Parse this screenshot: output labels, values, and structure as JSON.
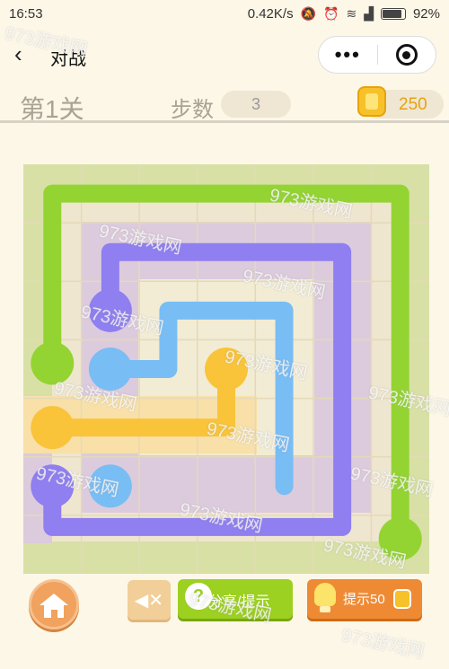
{
  "status_bar": {
    "time": "16:53",
    "network_speed": "0.42K/s",
    "battery": "92%",
    "icons": [
      "mute-icon",
      "alarm-icon",
      "wifi-icon",
      "signal-icon",
      "battery-icon"
    ]
  },
  "nav": {
    "title": "对战",
    "back_icon": "chevron-left-icon",
    "more_icon": "more-dots-icon",
    "close_icon": "target-close-icon"
  },
  "level": {
    "label": "第1关",
    "steps_label": "步数",
    "steps_value": "3",
    "coins": "250"
  },
  "board": {
    "rows": 7,
    "cols": 7,
    "colors": {
      "green": "#94d432",
      "purple": "#8f7ff0",
      "blue": "#79bdf5",
      "yellow": "#f9c43a",
      "grid_bg": "#f0e8d0",
      "grid_line": "#e5d9b9"
    },
    "paths": [
      {
        "color": "green",
        "cells": [
          [
            6,
            3
          ],
          [
            6,
            0
          ],
          [
            12,
            0
          ],
          [
            12,
            6
          ]
        ],
        "endpoints": [
          [
            0,
            3
          ],
          [
            6,
            6
          ]
        ]
      },
      {
        "color": "purple",
        "cells": [
          [
            1,
            2
          ],
          [
            1,
            1
          ],
          [
            5,
            1
          ],
          [
            5,
            6
          ],
          [
            0,
            6
          ],
          [
            0,
            5
          ]
        ],
        "endpoints": [
          [
            1,
            2
          ],
          [
            0,
            5
          ]
        ]
      },
      {
        "color": "blue",
        "cells": [
          [
            1,
            3
          ],
          [
            2,
            3
          ],
          [
            2,
            2
          ],
          [
            4,
            2
          ],
          [
            4,
            5
          ]
        ],
        "endpoints": [
          [
            1,
            3
          ],
          [
            1,
            5
          ]
        ]
      },
      {
        "color": "yellow",
        "cells": [
          [
            0,
            4
          ],
          [
            3,
            4
          ],
          [
            3,
            3
          ]
        ],
        "endpoints": [
          [
            0,
            4
          ],
          [
            3,
            3
          ]
        ]
      }
    ]
  },
  "controls": {
    "home_icon": "home-icon",
    "mute_icon": "speaker-mute-icon",
    "share_label": "分享/提示",
    "share_icon": "question-icon",
    "hint_label": "提示50",
    "hint_icon": "lightbulb-icon",
    "coin_icon": "coin-icon"
  },
  "watermark_text": "973游戏网"
}
